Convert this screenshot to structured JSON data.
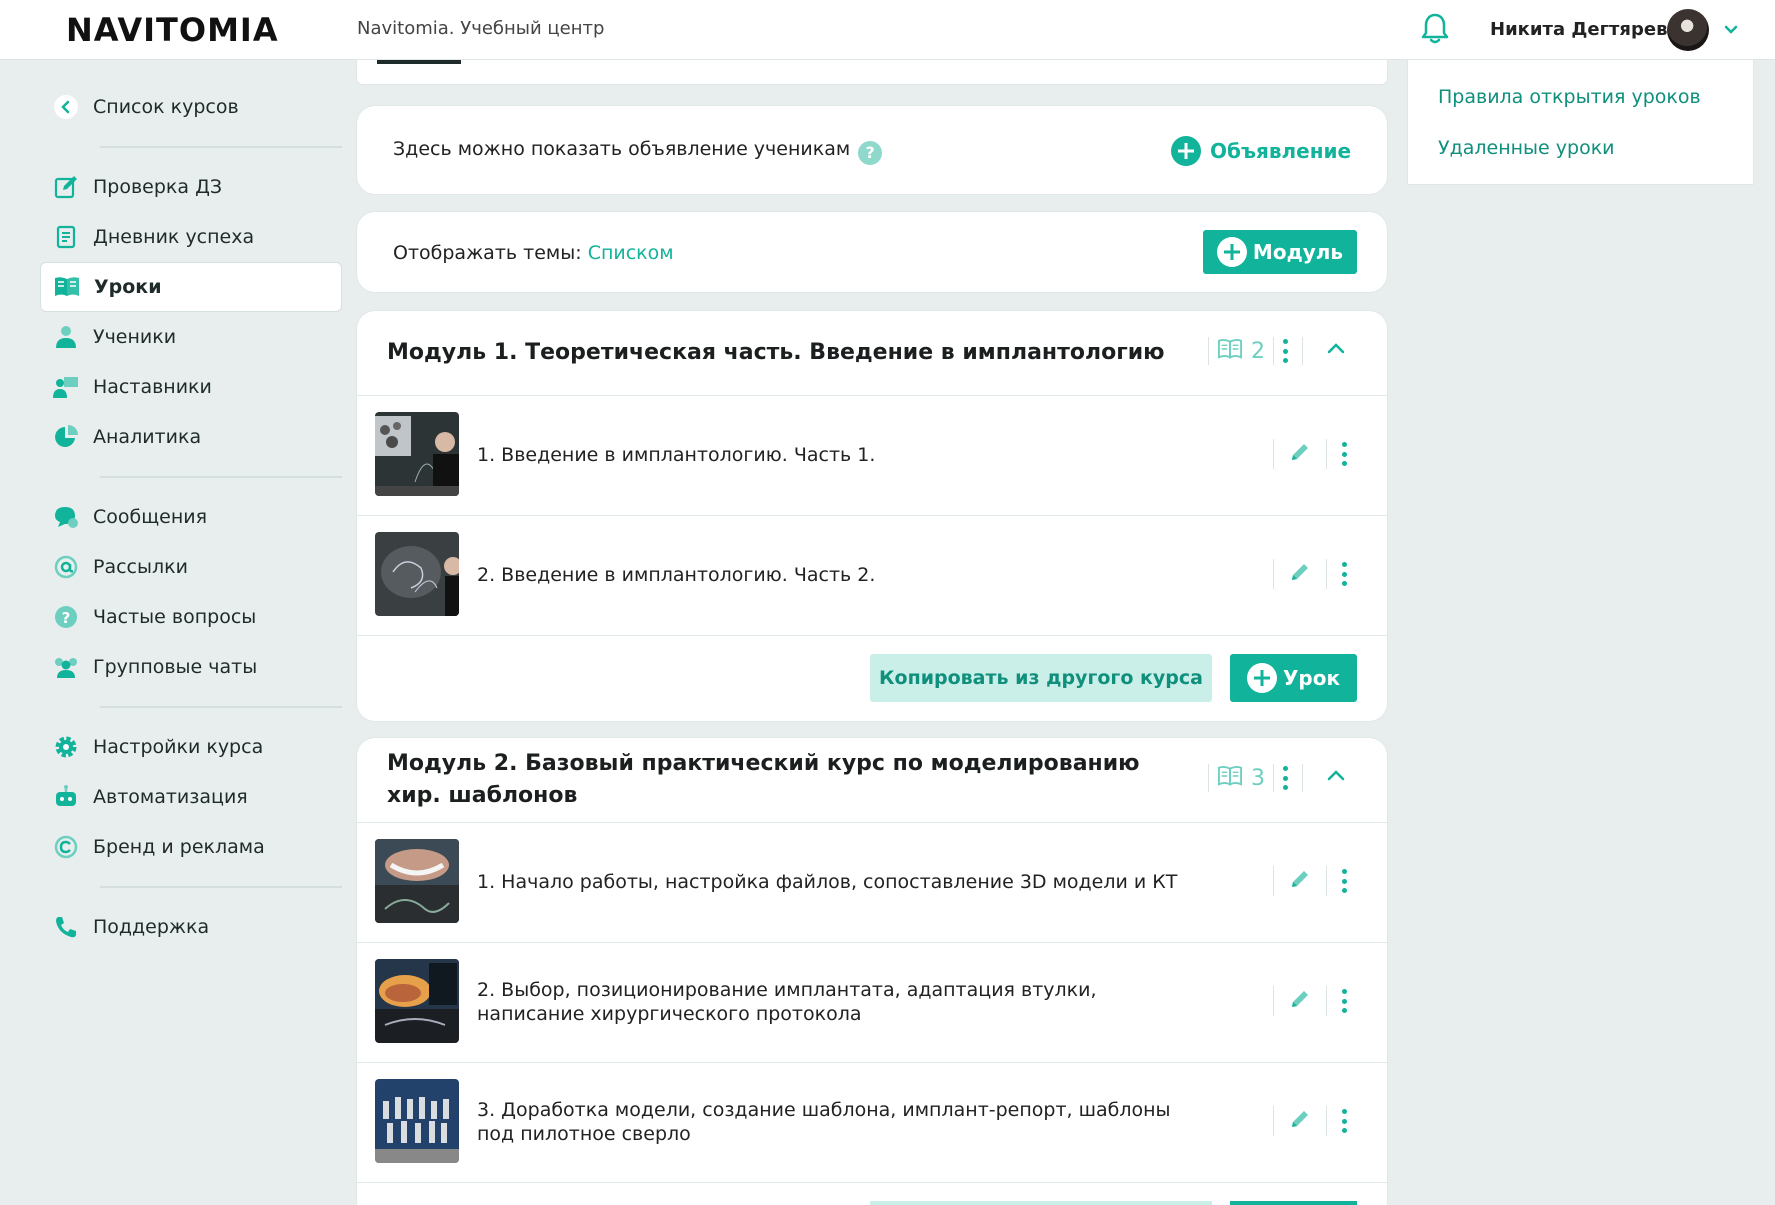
{
  "header": {
    "logo": "NAVITOMIA",
    "subtitle": "Navitomia. Учебный центр",
    "user_name": "Никита Дегтярев"
  },
  "sidebar": {
    "back": "Список курсов",
    "items": [
      {
        "label": "Проверка ДЗ",
        "icon": "edit-icon"
      },
      {
        "label": "Дневник успеха",
        "icon": "document-icon"
      },
      {
        "label": "Уроки",
        "icon": "book-icon",
        "active": true
      },
      {
        "label": "Ученики",
        "icon": "students-icon"
      },
      {
        "label": "Наставники",
        "icon": "mentors-icon"
      },
      {
        "label": "Аналитика",
        "icon": "pie-chart-icon"
      },
      {
        "label": "Сообщения",
        "icon": "chat-icon"
      },
      {
        "label": "Рассылки",
        "icon": "at-icon"
      },
      {
        "label": "Частые вопросы",
        "icon": "question-icon"
      },
      {
        "label": "Групповые чаты",
        "icon": "group-icon"
      },
      {
        "label": "Настройки курса",
        "icon": "gear-icon"
      },
      {
        "label": "Автоматизация",
        "icon": "robot-icon"
      },
      {
        "label": "Бренд и реклама",
        "icon": "copyright-icon"
      },
      {
        "label": "Поддержка",
        "icon": "phone-icon"
      }
    ]
  },
  "announce": {
    "text": "Здесь можно показать объявление ученикам",
    "help": "?",
    "button": "Объявление"
  },
  "display": {
    "label": "Отображать темы:",
    "mode": "Списком",
    "module_button": "Модуль"
  },
  "modules": [
    {
      "title": "Модуль 1. Теоретическая часть. Введение в имплантологию",
      "count": "2",
      "lessons": [
        "1. Введение в имплантологию. Часть 1.",
        "2. Введение в имплантологию. Часть 2."
      ],
      "copy_button": "Копировать из другого курса",
      "lesson_button": "Урок"
    },
    {
      "title": "Модуль 2. Базовый практический курс по моделированию хир. шаблонов",
      "count": "3",
      "lessons": [
        "1. Начало работы, настройка файлов, сопоставление 3D модели и КТ",
        "2. Выбор, позиционирование имплантата, адаптация втулки, написание хирургического протокола",
        "3. Доработка модели, создание шаблона, имплант-репорт, шаблоны под пилотное сверло"
      ]
    }
  ],
  "right_panel": {
    "link1": "Правила открытия уроков",
    "link2": "Удаленные уроки"
  },
  "colors": {
    "accent": "#12b39b",
    "background": "#e8eeee",
    "soft_button": "#c9efe8"
  }
}
